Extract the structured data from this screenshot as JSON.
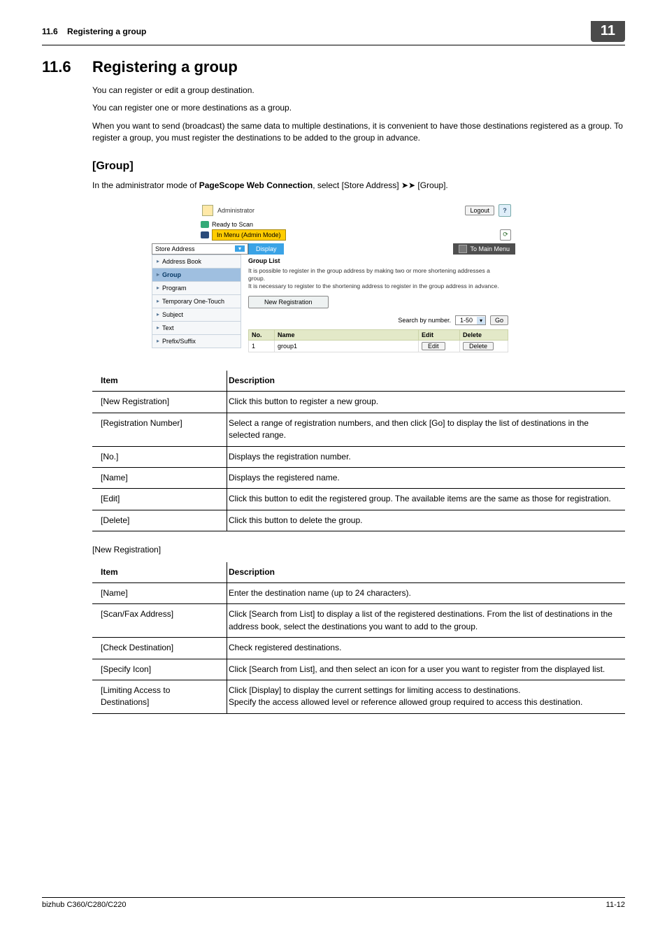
{
  "header": {
    "breadcrumb_num": "11.6",
    "breadcrumb_title": "Registering a group",
    "chapter_chip": "11"
  },
  "section": {
    "number": "11.6",
    "title": "Registering a group",
    "para1": "You can register or edit a group destination.",
    "para2": "You can register one or more destinations as a group.",
    "para3": "When you want to send (broadcast) the same data to multiple destinations, it is convenient to have those destinations registered as a group. To register a group, you must register the destinations to be added to the group in advance."
  },
  "group_heading": "[Group]",
  "group_intro_pre": "In the administrator mode of ",
  "group_intro_bold": "PageScope Web Connection",
  "group_intro_post": ", select [Store Address] ➤➤ [Group].",
  "admin_ui": {
    "administrator_label": "Administrator",
    "logout_label": "Logout",
    "help_glyph": "?",
    "ready_label": "Ready to Scan",
    "menu_label": "In Menu (Admin Mode)",
    "refresh_glyph": "⟳",
    "store_label": "Store Address",
    "display_label": "Display",
    "to_main_label": "To Main Menu",
    "side_items": [
      {
        "label": "Address Book",
        "tri": "▸"
      },
      {
        "label": "Group",
        "tri": "▸"
      },
      {
        "label": "Program",
        "tri": "▸"
      },
      {
        "label": "Temporary One-Touch",
        "tri": "▸"
      },
      {
        "label": "Subject",
        "tri": "▸"
      },
      {
        "label": "Text",
        "tri": "▸"
      },
      {
        "label": "Prefix/Suffix",
        "tri": "▸"
      }
    ],
    "group_list_title": "Group List",
    "group_list_desc": "It is possible to register in the group address by making two or more shortening addresses a group.\nIt is necessary to register to the shortening address to register in the group address in advance.",
    "newreg_label": "New Registration",
    "search_label": "Search by number.",
    "range_label": "1-50",
    "go_label": "Go",
    "th_no": "No.",
    "th_name": "Name",
    "th_edit": "Edit",
    "th_delete": "Delete",
    "r_no": "1",
    "r_name": "group1",
    "r_edit": "Edit",
    "r_delete": "Delete"
  },
  "table1": {
    "h_item": "Item",
    "h_desc": "Description",
    "rows": [
      {
        "item": "[New Registration]",
        "desc": "Click this button to register a new group."
      },
      {
        "item": "[Registration Number]",
        "desc": "Select a range of registration numbers, and then click [Go] to display the list of destinations in the selected range."
      },
      {
        "item": "[No.]",
        "desc": "Displays the registration number."
      },
      {
        "item": "[Name]",
        "desc": "Displays the registered name."
      },
      {
        "item": "[Edit]",
        "desc": "Click this button to edit the registered group. The available items are the same as those for registration."
      },
      {
        "item": "[Delete]",
        "desc": "Click this button to delete the group."
      }
    ]
  },
  "table2_caption": "[New Registration]",
  "table2": {
    "h_item": "Item",
    "h_desc": "Description",
    "rows": [
      {
        "item": "[Name]",
        "desc": "Enter the destination name (up to 24 characters)."
      },
      {
        "item": "[Scan/Fax Address]",
        "desc": "Click [Search from List] to display a list of the registered destinations. From the list of destinations in the address book, select the destinations you want to add to the group."
      },
      {
        "item": "[Check Destination]",
        "desc": "Check registered destinations."
      },
      {
        "item": "[Specify Icon]",
        "desc": "Click [Search from List], and then select an icon for a user you want to register from the displayed list."
      },
      {
        "item": "[Limiting Access to Destinations]",
        "desc": "Click [Display] to display the current settings for limiting access to destinations.\nSpecify the access allowed level or reference allowed group required to access this destination."
      }
    ]
  },
  "footer": {
    "left": "bizhub C360/C280/C220",
    "right": "11-12"
  }
}
